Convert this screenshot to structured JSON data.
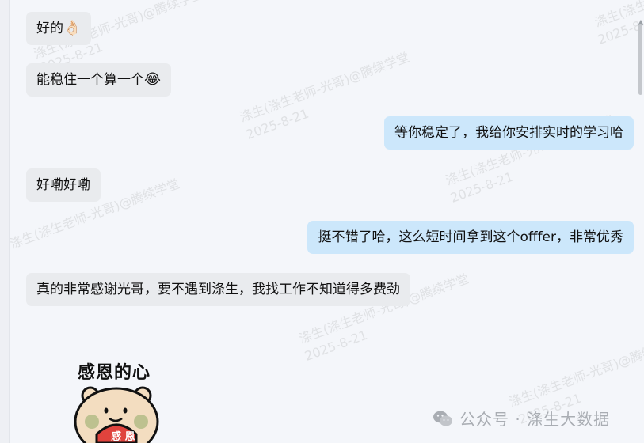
{
  "messages": [
    {
      "side": "in",
      "text": "好的",
      "emoji": "👌🏻"
    },
    {
      "side": "in",
      "text": "能稳住一个算一个",
      "emoji": "😂"
    },
    {
      "side": "out",
      "text": "等你稳定了，我给你安排实时的学习哈"
    },
    {
      "side": "in",
      "text": "好嘞好嘞"
    },
    {
      "side": "out",
      "text": "挺不错了哈，这么短时间拿到这个offfer，非常优秀"
    },
    {
      "side": "in",
      "text": "真的非常感谢光哥，要不遇到涤生，我找工作不知道得多费劲"
    }
  ],
  "sticker": {
    "title": "感恩的心",
    "tag": "感 恩"
  },
  "watermark": {
    "line1": "涤生(涤生老师-光哥)@腾续学堂",
    "line2": "2025-8-21"
  },
  "footer": {
    "text": "公众号 · 涤生大数据"
  },
  "colors": {
    "incoming": "#e9ebee",
    "outgoing": "#cce7fb",
    "background": "#f4f6fa"
  }
}
